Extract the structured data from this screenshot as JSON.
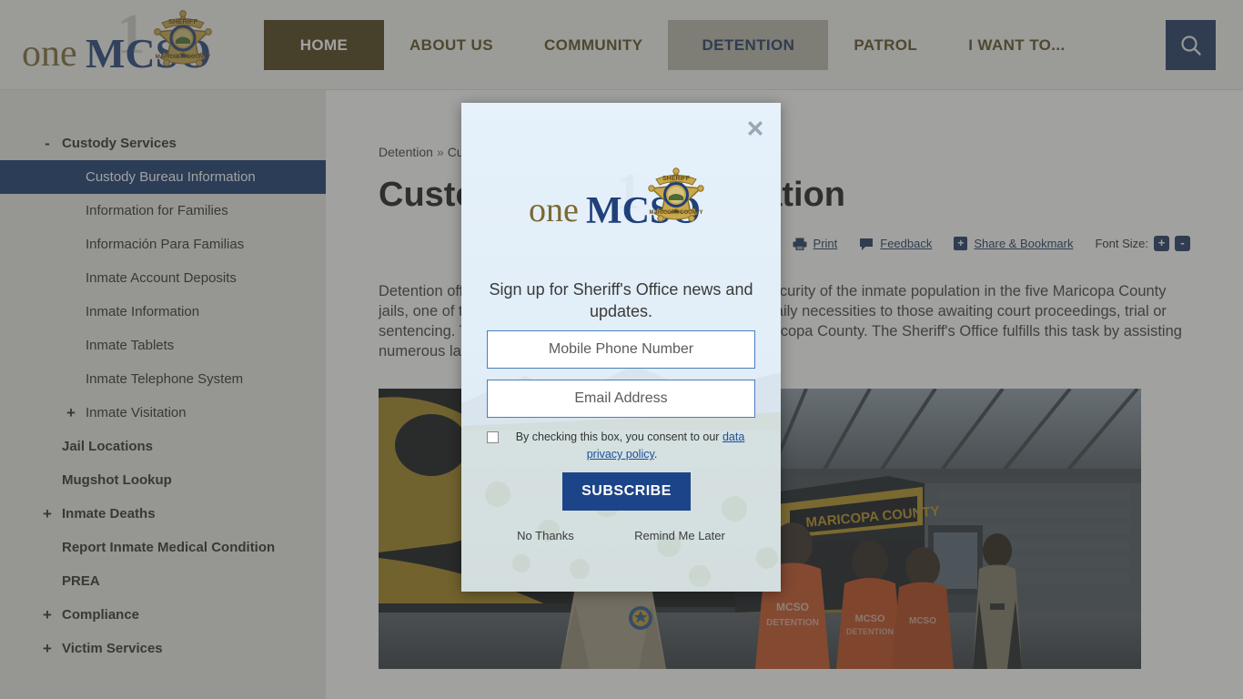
{
  "header": {
    "logo": {
      "word_one": "one",
      "word_mcso": "MCSO",
      "badge_top": "SHERIFF",
      "badge_bottom": "MARICOPA COUNTY",
      "badge_digit": "1"
    },
    "nav": [
      {
        "label": "HOME",
        "state": "home"
      },
      {
        "label": "ABOUT US",
        "state": "normal"
      },
      {
        "label": "COMMUNITY",
        "state": "normal"
      },
      {
        "label": "DETENTION",
        "state": "active"
      },
      {
        "label": "PATROL",
        "state": "normal"
      },
      {
        "label": "I WANT TO...",
        "state": "normal"
      }
    ],
    "search_icon": "search-icon",
    "colors": {
      "home_bg": "#4a3c14",
      "active_bg": "#b9b6ac",
      "active_text": "#1c3560",
      "search_bg": "#1c3560"
    }
  },
  "sidebar": {
    "items": [
      {
        "label": "Custody Services",
        "toggle": "-",
        "depth": 1,
        "selected": false
      },
      {
        "label": "Custody Bureau Information",
        "toggle": "",
        "depth": 2,
        "selected": true
      },
      {
        "label": "Information for Families",
        "toggle": "",
        "depth": 2,
        "selected": false
      },
      {
        "label": "Información Para Familias",
        "toggle": "",
        "depth": 2,
        "selected": false
      },
      {
        "label": "Inmate Account Deposits",
        "toggle": "",
        "depth": 2,
        "selected": false
      },
      {
        "label": "Inmate Information",
        "toggle": "",
        "depth": 2,
        "selected": false
      },
      {
        "label": "Inmate Tablets",
        "toggle": "",
        "depth": 2,
        "selected": false
      },
      {
        "label": "Inmate Telephone System",
        "toggle": "",
        "depth": 2,
        "selected": false
      },
      {
        "label": "Inmate Visitation",
        "toggle": "+",
        "depth": 2,
        "selected": false
      },
      {
        "label": "Jail Locations",
        "toggle": "",
        "depth": 1,
        "selected": false
      },
      {
        "label": "Mugshot Lookup",
        "toggle": "",
        "depth": 1,
        "selected": false
      },
      {
        "label": "Inmate Deaths",
        "toggle": "+",
        "depth": 1,
        "selected": false
      },
      {
        "label": "Report Inmate Medical Condition",
        "toggle": "",
        "depth": 1,
        "selected": false
      },
      {
        "label": "PREA",
        "toggle": "",
        "depth": 1,
        "selected": false
      },
      {
        "label": "Compliance",
        "toggle": "+",
        "depth": 1,
        "selected": false
      },
      {
        "label": "Victim Services",
        "toggle": "+",
        "depth": 1,
        "selected": false
      }
    ],
    "selected_bg": "#12376e"
  },
  "content": {
    "breadcrumb": [
      "Detention",
      "Custody Services"
    ],
    "breadcrumb_separator": "»",
    "title": "Custody Bureau Information",
    "toolbar": {
      "print": "Print",
      "feedback": "Feedback",
      "share": "Share & Bookmark",
      "share_badge": "+",
      "font_size_label": "Font Size:",
      "font_increase": "+",
      "font_decrease": "-"
    },
    "intro": "Detention officers are responsible for the care, safety and security of the inmate population in the five Maricopa County jails, one of the nation's largest. Detention officers provide daily necessities to those awaiting court proceedings, trial or sentencing. The MCSO is the primary booking facility in Maricopa County. The Sheriff's Office fulfills this task by assisting numerous law enforcement agencies in booking inmates.",
    "hero_caption": "MCSO detention officers escorting inmates in orange MCSO DETENTION uniforms to a Maricopa County transport bus"
  },
  "modal": {
    "close_icon": "close-icon",
    "logo_alt": "oneMCSO Maricopa County Sheriff badge logo",
    "headline": "Sign up for Sheriff's Office news and updates.",
    "phone_placeholder": "Mobile Phone Number",
    "phone_value": "",
    "email_placeholder": "Email Address",
    "email_value": "",
    "consent_prefix": "By checking this box, you consent to our ",
    "consent_link": "data privacy policy",
    "consent_suffix": ".",
    "consent_checked": false,
    "subscribe_label": "SUBSCRIBE",
    "no_thanks_label": "No Thanks",
    "remind_label": "Remind Me Later",
    "colors": {
      "subscribe_bg": "#1c4589",
      "input_border": "#4a7ebb",
      "panel_bg": "#ddeaf6"
    }
  }
}
